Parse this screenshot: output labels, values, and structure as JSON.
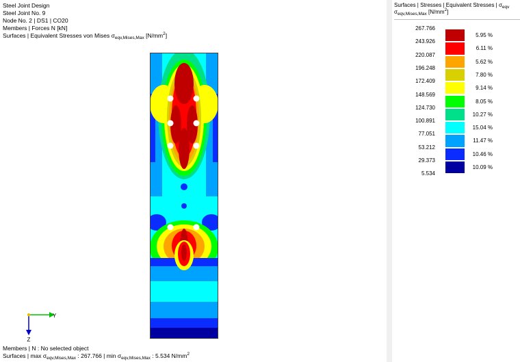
{
  "header": {
    "line1": "Steel Joint Design",
    "line2": "Steel Joint No. 9",
    "line3": "Node No. 2 | DS1 | CO20",
    "line4": "Members | Forces N [kN]",
    "line5_prefix": "Surfaces | Equivalent Stresses von Mises σ",
    "line5_sub": "eqv,Mises,Max",
    "line5_unit": " [N/mm",
    "line5_sup": "2",
    "line5_end": "]"
  },
  "footer": {
    "line1": "Members | N : No selected object",
    "line2_prefix": "Surfaces | max σ",
    "line2_sub1": "eqv,Mises,Max",
    "line2_mid": " : 267.766 | min σ",
    "line2_sub2": "eqv,Mises,Max",
    "line2_mid2": " : 5.534 N/mm",
    "line2_sup": "2"
  },
  "axes": {
    "y_label": "Y",
    "z_label": "Z"
  },
  "legend": {
    "title_line1": "Surfaces | Stresses | Equivalent Stresses | σ",
    "title_line1_sub": "eqv",
    "title_line2_sub": "eqv,Mises,Max",
    "title_line2_unit": " [N/mm",
    "title_line2_sup": "2",
    "title_line2_end": "]",
    "ticks": [
      "267.766",
      "243.926",
      "220.087",
      "196.248",
      "172.409",
      "148.569",
      "124.730",
      "100.891",
      "77.051",
      "53.212",
      "29.373",
      "5.534"
    ],
    "bands": [
      {
        "color": "#c00000",
        "percent": "5.95 %"
      },
      {
        "color": "#ff0000",
        "percent": "6.11 %"
      },
      {
        "color": "#ffa500",
        "percent": "5.62 %"
      },
      {
        "color": "#d8d000",
        "percent": "7.80 %"
      },
      {
        "color": "#ffff00",
        "percent": "9.14 %"
      },
      {
        "color": "#00ff00",
        "percent": "8.05 %"
      },
      {
        "color": "#00e08a",
        "percent": "10.27 %"
      },
      {
        "color": "#00ffff",
        "percent": "15.04 %"
      },
      {
        "color": "#00a2ff",
        "percent": "11.47 %"
      },
      {
        "color": "#0a2cff",
        "percent": "10.46 %"
      },
      {
        "color": "#0000a0",
        "percent": "10.09 %"
      }
    ]
  },
  "colors": {
    "very_high": "#c00000",
    "high": "#ff0000",
    "orange": "#ffa500",
    "olive": "#d8d000",
    "yellow": "#ffff00",
    "green": "#00ff00",
    "teal": "#00e08a",
    "cyan": "#00ffff",
    "light_blue": "#00a2ff",
    "blue": "#0a2cff",
    "dark_blue": "#0000a0",
    "axis_y": "#00c000",
    "axis_z": "#0000c8"
  }
}
